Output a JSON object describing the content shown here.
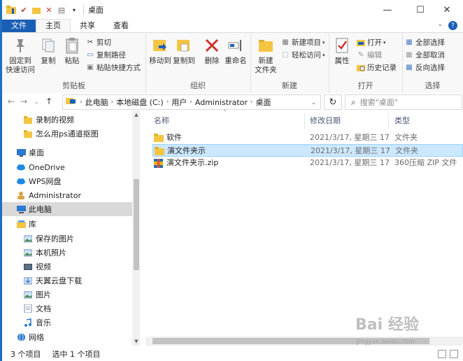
{
  "window": {
    "title": "桌面",
    "controls": {
      "minimize": "—",
      "maximize": "☐",
      "close": "✕"
    }
  },
  "ribbon_tabs": [
    "文件",
    "主页",
    "共享",
    "查看"
  ],
  "ribbon": {
    "clipboard": {
      "label": "剪贴板",
      "pin_quick_access": "固定到\n快速访问",
      "copy": "复制",
      "paste": "粘贴",
      "cut": "剪切",
      "copy_path": "复制路径",
      "paste_shortcut": "粘贴快捷方式"
    },
    "organize": {
      "label": "组织",
      "move_to": "移动到",
      "copy_to": "复制到",
      "delete": "删除",
      "rename": "重命名"
    },
    "new": {
      "label": "新建",
      "new_folder": "新建\n文件夹",
      "new_item": "新建项目",
      "easy_access": "轻松访问"
    },
    "open": {
      "label": "打开",
      "properties": "属性",
      "open": "打开",
      "edit": "编辑",
      "history": "历史记录"
    },
    "select": {
      "label": "选择",
      "select_all": "全部选择",
      "select_none": "全部取消",
      "invert": "反向选择"
    }
  },
  "address": {
    "segments": [
      "此电脑",
      "本地磁盘 (C:)",
      "用户",
      "Administrator",
      "桌面"
    ],
    "search_placeholder": "搜索\"桌面\""
  },
  "nav_pane": {
    "items": [
      {
        "label": "录制的视频",
        "icon": "folder-icon",
        "indent": 1
      },
      {
        "label": "怎么用ps通道抠图",
        "icon": "folder-icon",
        "indent": 1
      },
      {
        "label": "桌面",
        "icon": "desktop-icon",
        "indent": 0
      },
      {
        "label": "OneDrive",
        "icon": "cloud-icon",
        "indent": 0
      },
      {
        "label": "WPS网盘",
        "icon": "cloud-icon",
        "indent": 0
      },
      {
        "label": "Administrator",
        "icon": "user-icon",
        "indent": 0
      },
      {
        "label": "此电脑",
        "icon": "computer-icon",
        "indent": 0,
        "selected": true
      },
      {
        "label": "库",
        "icon": "library-icon",
        "indent": 0
      },
      {
        "label": "保存的图片",
        "icon": "pictures-icon",
        "indent": 1
      },
      {
        "label": "本机照片",
        "icon": "pictures-icon",
        "indent": 1
      },
      {
        "label": "视频",
        "icon": "video-icon",
        "indent": 1
      },
      {
        "label": "天翼云盘下载",
        "icon": "download-icon",
        "indent": 1
      },
      {
        "label": "图片",
        "icon": "pictures-icon",
        "indent": 1
      },
      {
        "label": "文档",
        "icon": "document-icon",
        "indent": 1
      },
      {
        "label": "音乐",
        "icon": "music-icon",
        "indent": 1
      },
      {
        "label": "网络",
        "icon": "network-icon",
        "indent": 0
      }
    ]
  },
  "file_list": {
    "columns": [
      "名称",
      "修改日期",
      "类型"
    ],
    "rows": [
      {
        "name": "软件",
        "date": "2021/3/17, 星期三 17...",
        "type": "文件夹",
        "icon": "folder-icon",
        "selected": false
      },
      {
        "name": "演文件夹示",
        "date": "2021/3/17, 星期三 17...",
        "type": "文件夹",
        "icon": "folder-icon",
        "selected": true
      },
      {
        "name": "演文件夹示.zip",
        "date": "2021/3/17, 星期三 17...",
        "type": "360压缩 ZIP 文件",
        "icon": "zip-icon",
        "selected": false
      }
    ]
  },
  "status_bar": {
    "item_count": "3 个项目",
    "selection": "选中 1 个项目"
  },
  "watermark": {
    "text": "Bai 经验",
    "sub": "jingyan.baidu.com"
  },
  "colors": {
    "accent": "#1a5fb4",
    "selection": "#cce8ff",
    "selection_border": "#99d1ff",
    "folder": "#f4c542"
  }
}
